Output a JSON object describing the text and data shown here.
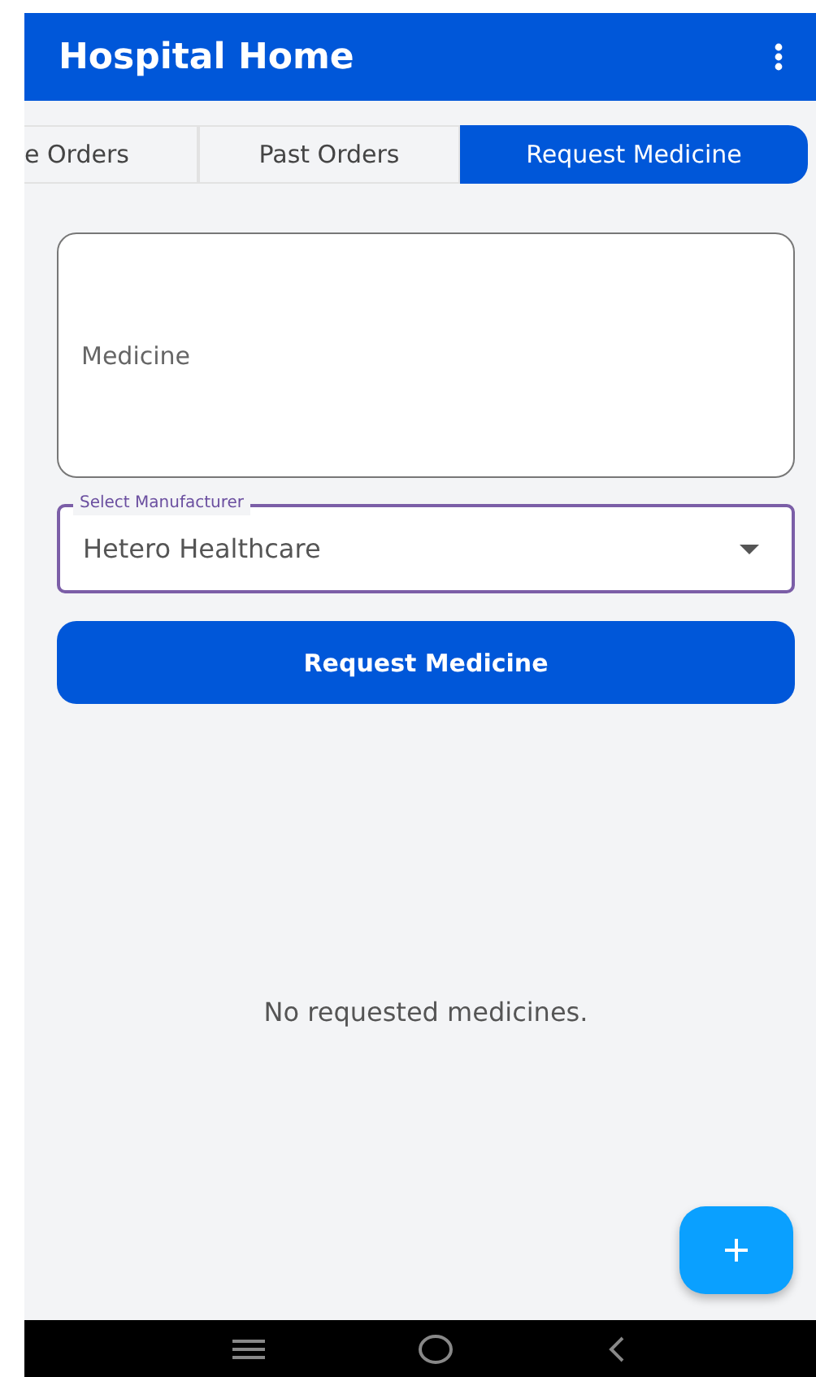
{
  "app_bar": {
    "title": "Hospital Home"
  },
  "tabs": [
    {
      "label": "e Orders",
      "selected": false
    },
    {
      "label": "Past Orders",
      "selected": false
    },
    {
      "label": "Request Medicine",
      "selected": true
    }
  ],
  "medicine_field": {
    "placeholder": "Medicine"
  },
  "manufacturer_select": {
    "label": "Select Manufacturer",
    "value": "Hetero Healthcare"
  },
  "submit_button": {
    "label": "Request Medicine"
  },
  "empty_message": "No requested medicines."
}
